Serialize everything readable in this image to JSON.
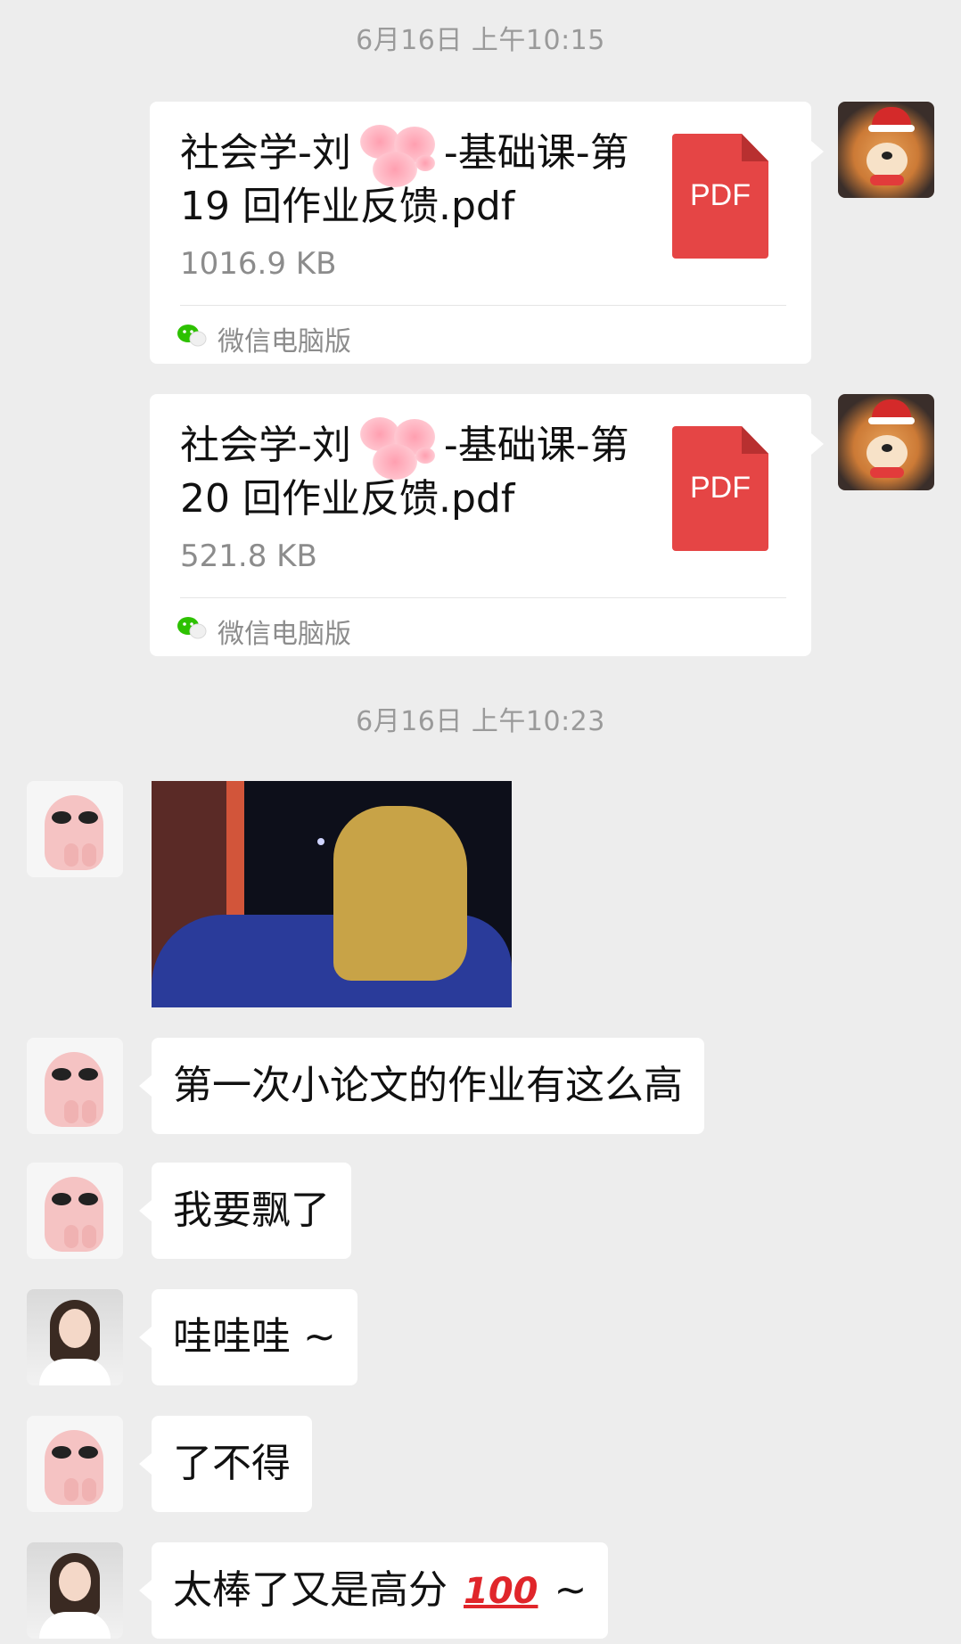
{
  "timestamps": [
    "6月16日 上午10:15",
    "6月16日 上午10:23"
  ],
  "files": [
    {
      "name_start": "社会学-刘",
      "name_end": "-基础课-第19 回作业反馈.pdf",
      "size": "1016.9 KB",
      "icon_label": "PDF",
      "source": "微信电脑版"
    },
    {
      "name_start": "社会学-刘",
      "name_end": "-基础课-第20 回作业反馈.pdf",
      "size": "521.8 KB",
      "icon_label": "PDF",
      "source": "微信电脑版"
    }
  ],
  "messages": [
    {
      "text": "第一次小论文的作业有这么高"
    },
    {
      "text": "我要飘了"
    },
    {
      "text": "哇哇哇 ~"
    },
    {
      "text": "了不得"
    },
    {
      "text_before": "太棒了又是高分",
      "emoji": "100",
      "text_after": "~"
    }
  ],
  "icons": {
    "pdf": "pdf-file-icon",
    "source": "wechat-icon"
  },
  "colors": {
    "background": "#ededed",
    "pdf": "#e54545",
    "wechat": "#2dc100",
    "bubble": "#ffffff",
    "meta_text": "#8c8c8c"
  }
}
